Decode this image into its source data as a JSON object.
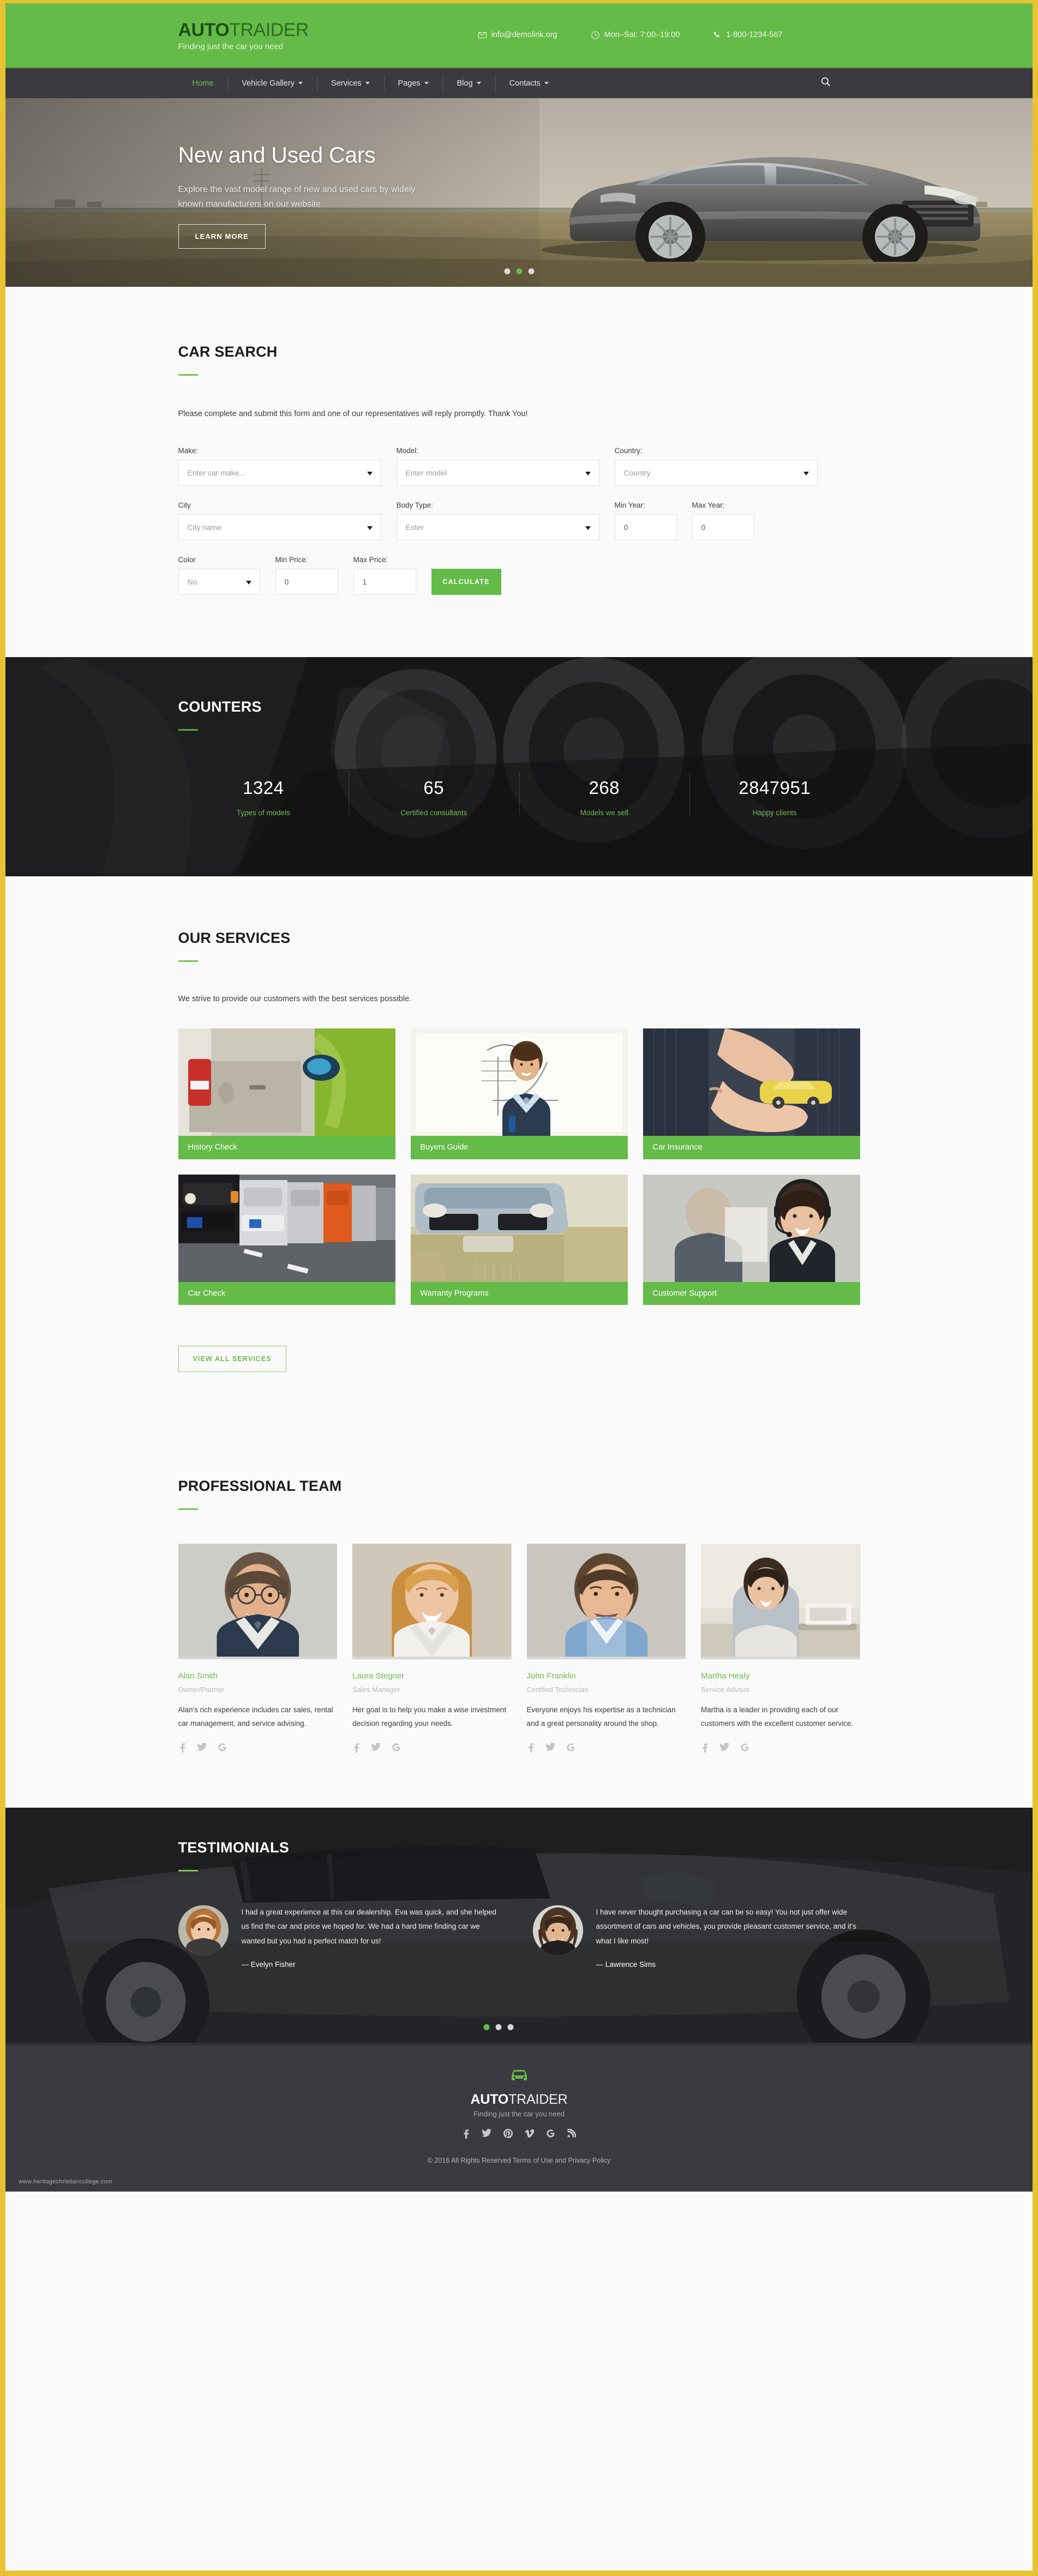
{
  "brand": {
    "name_bold": "AUTO",
    "name_light": "TRAIDER",
    "tagline": "Finding just the car you need"
  },
  "header": {
    "email": "info@demolink.org",
    "hours": "Mon–Sat: 7:00–19:00",
    "phone": "1-800-1234-567",
    "email_icon": "envelope-icon",
    "hours_icon": "clock-icon",
    "phone_icon": "phone-icon"
  },
  "nav": {
    "items": [
      {
        "label": "Home",
        "dropdown": false,
        "active": true
      },
      {
        "label": "Vehicle Gallery",
        "dropdown": true,
        "active": false
      },
      {
        "label": "Services",
        "dropdown": true,
        "active": false
      },
      {
        "label": "Pages",
        "dropdown": true,
        "active": false
      },
      {
        "label": "Blog",
        "dropdown": true,
        "active": false
      },
      {
        "label": "Contacts",
        "dropdown": true,
        "active": false
      }
    ],
    "search_icon": "search-icon"
  },
  "hero": {
    "title": "New and Used Cars",
    "subtitle": "Explore the vast model range of new and used cars by widely known manufacturers on our website.",
    "button": "LEARN MORE",
    "slides": 3,
    "active_slide": 1
  },
  "search": {
    "title": "CAR SEARCH",
    "lead": "Please complete and submit this form and one of our representatives will reply promptly. Thank You!",
    "fields": {
      "make": {
        "label": "Make:",
        "value": "Enter car make...",
        "type": "select"
      },
      "model": {
        "label": "Model:",
        "value": "Enter model",
        "type": "select"
      },
      "country": {
        "label": "Country:",
        "value": "Country",
        "type": "select"
      },
      "city": {
        "label": "City",
        "value": "City name",
        "type": "select"
      },
      "body_type": {
        "label": "Body Type:",
        "value": "Enter",
        "type": "select"
      },
      "min_year": {
        "label": "Min Year:",
        "value": "0",
        "type": "text"
      },
      "max_year": {
        "label": "Max Year:",
        "value": "0",
        "type": "text"
      },
      "color": {
        "label": "Color",
        "value": "No",
        "type": "select"
      },
      "min_price": {
        "label": "Min Price:",
        "value": "0",
        "type": "text"
      },
      "max_price": {
        "label": "Max Price:",
        "value": "1",
        "type": "text"
      }
    },
    "submit": "CALCULATE"
  },
  "counters": {
    "title": "COUNTERS",
    "items": [
      {
        "value": "1324",
        "label": "Types of models"
      },
      {
        "value": "65",
        "label": "Certified consultants"
      },
      {
        "value": "268",
        "label": "Models we sell"
      },
      {
        "value": "2847951",
        "label": "Happy clients"
      }
    ]
  },
  "services": {
    "title": "OUR SERVICES",
    "lead": "We strive to provide our customers with the best services possible.",
    "cards": [
      {
        "caption": "History Check",
        "image": "car-taillight-green-field"
      },
      {
        "caption": "Buyers Guide",
        "image": "businessman-whiteboard"
      },
      {
        "caption": "Car Insurance",
        "image": "hands-holding-toy-car"
      },
      {
        "caption": "Car Check",
        "image": "row-of-parked-cars"
      },
      {
        "caption": "Warranty Programs",
        "image": "silver-car-in-field"
      },
      {
        "caption": "Customer Support",
        "image": "support-agent-headset"
      }
    ],
    "view_all": "VIEW ALL SERVICES"
  },
  "team": {
    "title": "PROFESSIONAL TEAM",
    "members": [
      {
        "name": "Alan Smith",
        "role": "Owner/Partner",
        "bio": "Alan's rich experience includes car sales, rental car management, and service advising.",
        "photo": "smiling-man-glasses"
      },
      {
        "name": "Laura Stegner",
        "role": "Sales Manager",
        "bio": "Her goal is to help you make a wise investment decision regarding your needs.",
        "photo": "blonde-woman-smiling"
      },
      {
        "name": "John Franklin",
        "role": "Certified Technician",
        "bio": "Everyone enjoys his expertise as a technician and a great personality around the shop.",
        "photo": "young-man-blue-shirt"
      },
      {
        "name": "Martha Healy",
        "role": "Service Advisor",
        "bio": "Martha is a leader in providing each of our customers with the excellent customer service.",
        "photo": "woman-at-desk"
      }
    ],
    "social": [
      "facebook-icon",
      "twitter-icon",
      "google-plus-icon"
    ]
  },
  "testimonials": {
    "title": "TESTIMONIALS",
    "items": [
      {
        "text": "I had a great experience at this car dealership. Eva was quick, and she helped us find the car and price we hoped for. We had a hard time finding car we wanted but you had a perfect match for us!",
        "author": "— Evelyn Fisher",
        "avatar": "laughing-woman"
      },
      {
        "text": "I have never thought purchasing a car can be so easy! You not just offer wide assortment of cars and vehicles, you provide pleasant customer service, and it's what I like most!",
        "author": "— Lawrence Sims",
        "avatar": "smiling-man-long-hair"
      }
    ],
    "slides": 3,
    "active_slide": 0
  },
  "footer": {
    "logo_icon": "car-front-icon",
    "social": [
      "facebook-icon",
      "twitter-icon",
      "pinterest-icon",
      "vimeo-icon",
      "google-plus-icon",
      "rss-icon"
    ],
    "copyright": "© 2016 All Rights Reserved Terms of Use and Privacy Policy",
    "watermark": "www.heritagechristiancollege.com"
  },
  "colors": {
    "brand_green": "#65bb48",
    "accent_green": "#6fbd4c",
    "dark_nav": "#3b3a40",
    "page_border": "#e8c233"
  }
}
